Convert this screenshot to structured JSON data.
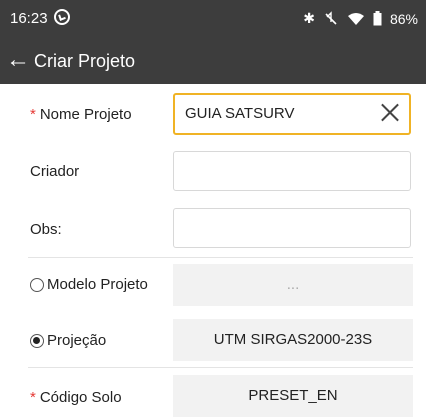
{
  "status_bar": {
    "time": "16:23",
    "battery": "86%",
    "icons": [
      "bluetooth-icon",
      "mute-icon",
      "wifi-icon",
      "battery-icon"
    ]
  },
  "app_bar": {
    "title": "Criar Projeto",
    "back_icon": "arrow-left-icon"
  },
  "form": {
    "required_mark": "*",
    "nome_projeto": {
      "label": "Nome Projeto",
      "value": "GUIA SATSURV"
    },
    "criador": {
      "label": "Criador",
      "value": ""
    },
    "obs": {
      "label": "Obs:",
      "value": ""
    },
    "modelo_projeto": {
      "label": "Modelo Projeto",
      "value": "...",
      "selected": false
    },
    "projecao": {
      "label": "Projeção",
      "value": "UTM SIRGAS2000-23S",
      "selected": true
    },
    "codigo_solo": {
      "label": "Código Solo",
      "value": "PRESET_EN"
    }
  },
  "colors": {
    "bar_background": "#3d3d3d",
    "active_border": "#f0b325",
    "required": "#e53935",
    "readonly_background": "#f2f2f2"
  }
}
